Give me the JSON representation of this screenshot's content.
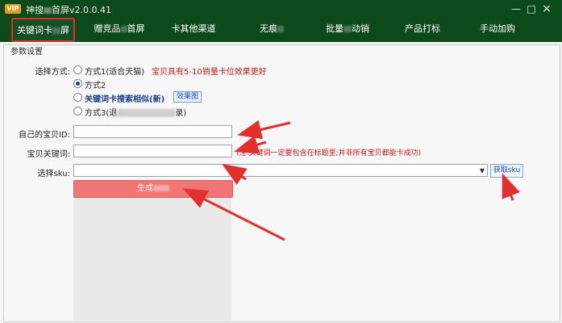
{
  "app": {
    "vip_badge": "VIP",
    "title_left": "神搜",
    "title_right": "首屏v2.0.0.41",
    "window_controls": {
      "minimize": "—",
      "maximize": "□",
      "close": "×"
    }
  },
  "nav": {
    "tabs": [
      {
        "label_left": "关键词卡",
        "label_right": "屏"
      },
      {
        "label_left": "赠竞品",
        "label_right": "首屏"
      },
      {
        "label_left": "卡其他渠道",
        "label_right": ""
      },
      {
        "label_left": "无痕",
        "label_right": ""
      },
      {
        "label_left": "批量",
        "label_right": "动销"
      },
      {
        "label_left": "产品打标",
        "label_right": ""
      },
      {
        "label_left": "手动加购",
        "label_right": ""
      }
    ]
  },
  "params": {
    "section_title": "参数设置",
    "method_label": "选择方式:",
    "options": [
      {
        "text": "方式1(适合天猫)",
        "note": "宝贝具有5-10销量卡位效果更好"
      },
      {
        "text": "方式2",
        "note": ""
      },
      {
        "text": "关键词卡搜索相似(新)",
        "note": "",
        "button": "效果图"
      },
      {
        "text_left": "方式3(退",
        "text_right": "录)",
        "note": ""
      }
    ],
    "id_label": "自己的宝贝ID:",
    "id_value": "",
    "keyword_label": "宝贝关键词:",
    "keyword_value": "",
    "keyword_note": "(注:关键词一定要包含在标题里;并非所有宝贝都能卡成功)",
    "sku_label": "选择sku:",
    "sku_value": "",
    "get_sku_button": "获取sku",
    "generate_button": "生成"
  }
}
